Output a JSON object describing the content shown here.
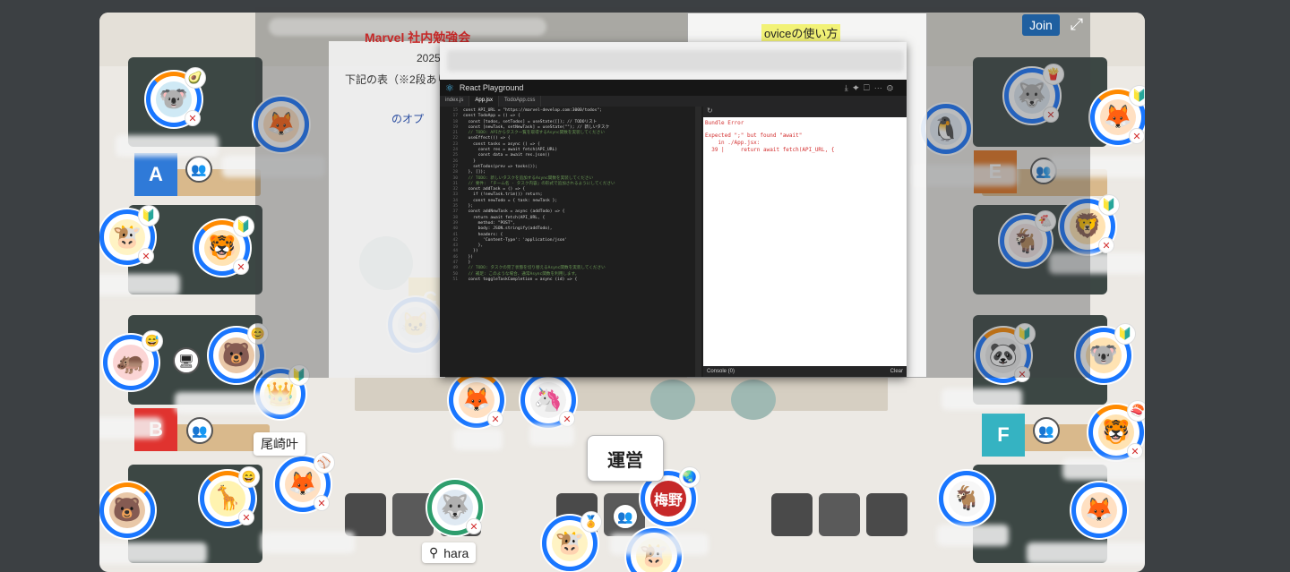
{
  "header": {
    "join_label": "Join",
    "expand_icon": "expand-icon"
  },
  "slides": {
    "left_visible": [
      "Marvel 社内勉強会",
      "2025",
      "下記の表（※2段あり",
      "のオプ"
    ],
    "right_title": "oviceの使い方"
  },
  "zones": [
    {
      "id": "A",
      "color": "#2f7ad8"
    },
    {
      "id": "B",
      "color": "#e0332f"
    },
    {
      "id": "C",
      "color": "#f3c51b"
    },
    {
      "id": "E",
      "color": "#e4741f"
    },
    {
      "id": "F",
      "color": "#35b3c2"
    }
  ],
  "labels": {
    "ozaki": "尾崎叶",
    "unei": "運営",
    "hara": "hara",
    "umeno": "梅野"
  },
  "shared_screen": {
    "app_title": "React Playground",
    "tabs": [
      "index.js",
      "App.jsx",
      "TodoApp.css"
    ],
    "code_lines": [
      {
        "n": "15",
        "t": "const API_URL = \"https://marvel-develop.com:3000/todos\";"
      },
      {
        "n": "17",
        "t": "const TodoApp = () => {"
      },
      {
        "n": "18",
        "t": "  const [todos, setTodos] = useState([]); // TODOリスト"
      },
      {
        "n": "19",
        "t": "  const [newTask, setNewTask] = useState(\"\"); // 新しいタスク"
      },
      {
        "n": "21",
        "t": "  // TODO: APIからタスク一覧を取得するAsync関数を実装してください"
      },
      {
        "n": "22",
        "t": "  useEffect(() => {"
      },
      {
        "n": "23",
        "t": "    const tasks = async () => {"
      },
      {
        "n": "24",
        "t": "      const res = await fetch(API_URL)"
      },
      {
        "n": "25",
        "t": "      const data = await res.json()"
      },
      {
        "n": "26",
        "t": "    }"
      },
      {
        "n": "27",
        "t": "    setTodos(prev => tasks());"
      },
      {
        "n": "28",
        "t": "  }, []);"
      },
      {
        "n": "30",
        "t": "  // TODO: 新しいタスクを追加するAsync関数を実装してください"
      },
      {
        "n": "31",
        "t": "  // 要件: 「チーム名 - タスク内容」の形式で追加されるようにしてください"
      },
      {
        "n": "32",
        "t": "  const addTask = () => {"
      },
      {
        "n": "33",
        "t": "    if (!newTask.trim()) return;"
      },
      {
        "n": "34",
        "t": "    const newTodo = { task: newTask };"
      },
      {
        "n": "35",
        "t": "  };"
      },
      {
        "n": "37",
        "t": "  const addNewTask = async (addTodo) => {"
      },
      {
        "n": "38",
        "t": "    return await fetch(API_URL, {"
      },
      {
        "n": "39",
        "t": "      method: \"POST\","
      },
      {
        "n": "40",
        "t": "      body: JSON.stringify(addTodo),"
      },
      {
        "n": "41",
        "t": "      headers: {"
      },
      {
        "n": "42",
        "t": "        'Content-Type': 'application/json'"
      },
      {
        "n": "43",
        "t": "      },"
      },
      {
        "n": "44",
        "t": "    })"
      },
      {
        "n": "46",
        "t": "  })"
      },
      {
        "n": "47",
        "t": "  }"
      },
      {
        "n": "49",
        "t": "  // TODO: タスクの完了状態を切り替えるAsync関数を実装してください"
      },
      {
        "n": "50",
        "t": "  // 補足: このような場合、通常Async関数を利用します。"
      },
      {
        "n": "51",
        "t": "  const toggleTaskCompletion = async (id) => {"
      }
    ],
    "preview_label": "Bundle Error",
    "error_lines": [
      "Expected \";\" but found \"await\"",
      "    in ./App.jsx:",
      "  39 |     return await fetch(API_URL, {"
    ],
    "console_label": "Console (0)",
    "clear_label": "Clear"
  }
}
